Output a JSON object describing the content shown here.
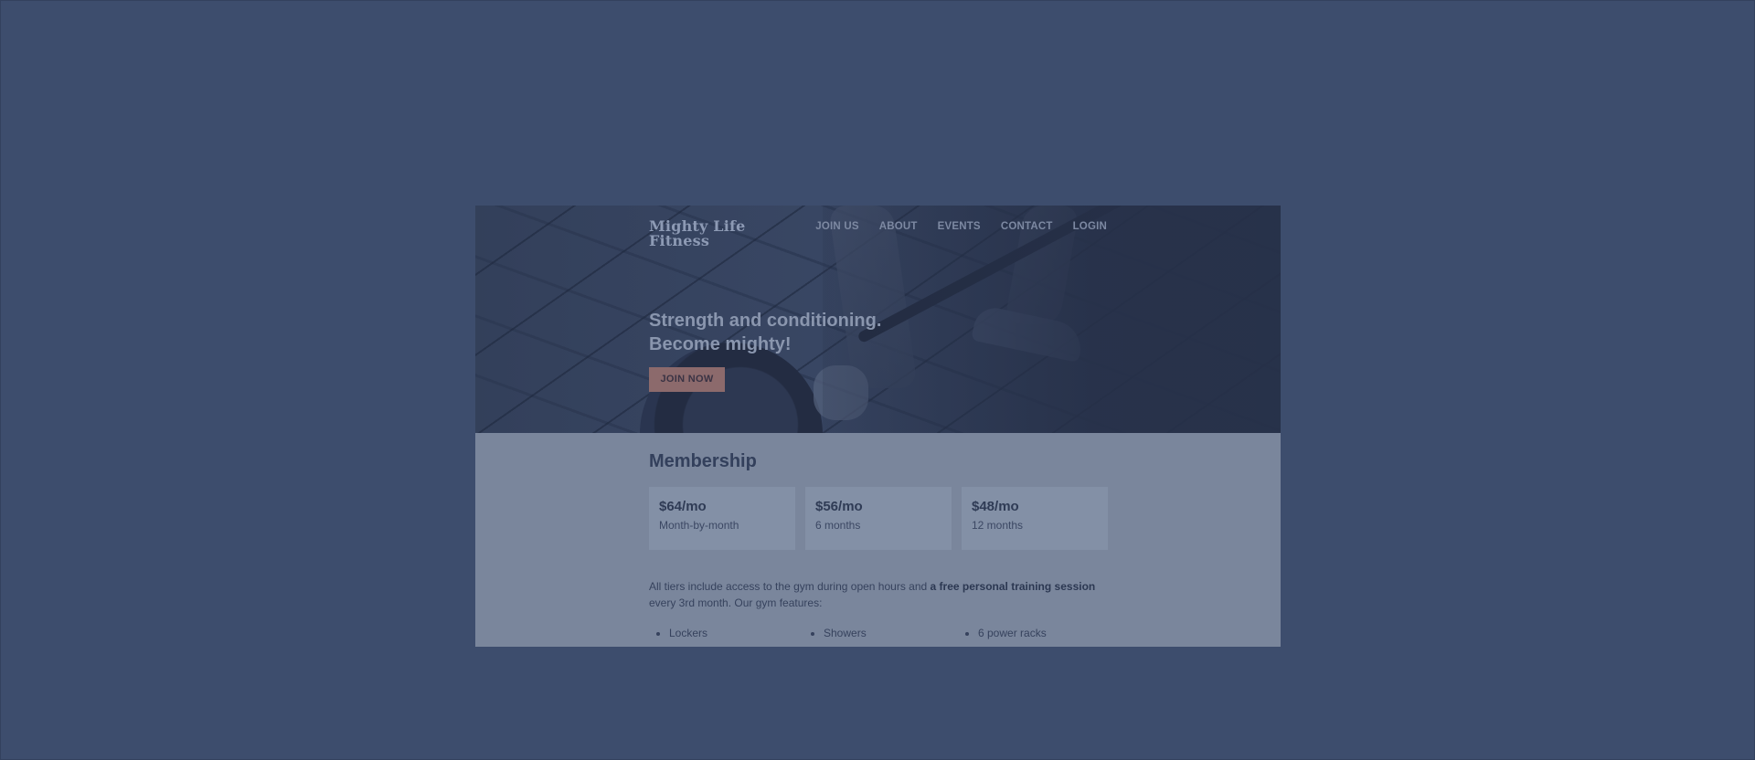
{
  "brand": {
    "line1": "Mighty Life",
    "line2": "Fitness"
  },
  "nav": {
    "items": [
      "JOIN US",
      "ABOUT",
      "EVENTS",
      "CONTACT",
      "LOGIN"
    ]
  },
  "hero": {
    "headline_line1": "Strength and conditioning.",
    "headline_line2": "Become mighty!",
    "cta_label": "JOIN NOW"
  },
  "membership": {
    "title": "Membership",
    "tiers": [
      {
        "price": "$64/mo",
        "term": "Month-by-month"
      },
      {
        "price": "$56/mo",
        "term": "6 months"
      },
      {
        "price": "$48/mo",
        "term": "12 months"
      }
    ],
    "description_part1": "All tiers include access to the gym during open hours and ",
    "description_bold": "a free personal training session",
    "description_part2": " every 3rd month. Our gym features:",
    "features": [
      "Lockers",
      "Showers",
      "6 power racks"
    ]
  },
  "colors": {
    "overlay": "#3d4d6d",
    "accent": "#8c6a6c",
    "content_bg": "#7a869c"
  }
}
